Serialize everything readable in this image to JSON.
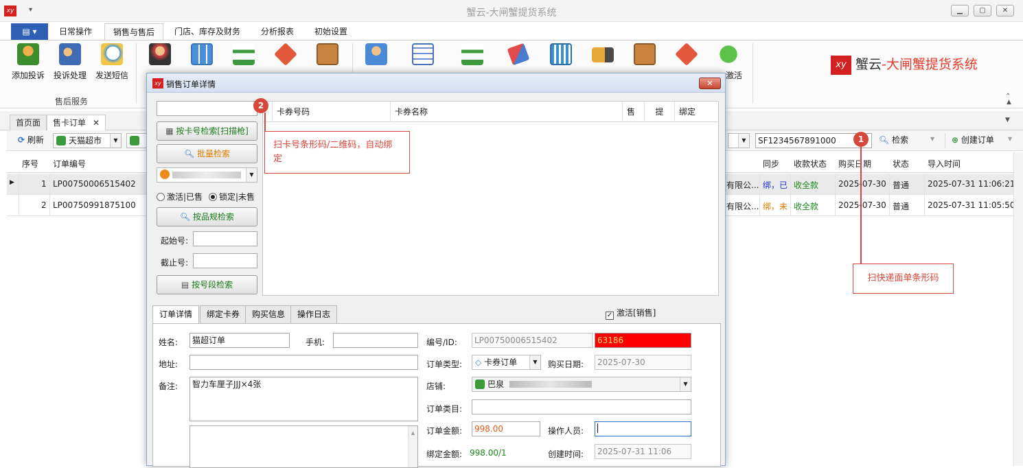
{
  "app": {
    "title": "蟹云-大闸蟹提货系统",
    "logo_text": "xy"
  },
  "ribbon_tabs": [
    {
      "label": "日常操作"
    },
    {
      "label": "销售与售后"
    },
    {
      "label": "门店、库存及财务"
    },
    {
      "label": "分析报表"
    },
    {
      "label": "初始设置"
    }
  ],
  "ribbon": {
    "service_buttons": [
      {
        "label": "添加投诉",
        "icon": "add-complaint-icon"
      },
      {
        "label": "投诉处理",
        "icon": "users-icon"
      },
      {
        "label": "发送短信",
        "icon": "chat-bubble-icon"
      }
    ],
    "group_label": "售后服务",
    "activate_label": "激活",
    "brand_prefix": "蟹云",
    "brand_suffix": "-大闸蟹提货系统"
  },
  "doc_tabs": [
    {
      "label": "首页面"
    },
    {
      "label": "售卡订单"
    }
  ],
  "toolbar": {
    "refresh": "刷新",
    "shop": "天猫超市",
    "tracking_value": "SF1234567891000",
    "search": "检索",
    "create": "创建订单"
  },
  "grid": {
    "headers": {
      "seq": "序号",
      "order_no": "订单编号",
      "sync": "同步",
      "pay_status": "收款状态",
      "date": "购买日期",
      "status": "状态",
      "import_time": "导入时间"
    },
    "rows": [
      {
        "seq": "1",
        "order_no": "LP00750006515402",
        "company": "有限公...",
        "sync": "绑，已",
        "pay_status": "收全款",
        "date": "2025-07-30",
        "status": "普通",
        "import_time": "2025-07-31 11:06:21"
      },
      {
        "seq": "2",
        "order_no": "LP00750991875100",
        "company": "有限公...",
        "sync": "绑，未",
        "pay_status": "收全款",
        "date": "2025-07-30",
        "status": "普通",
        "import_time": "2025-07-31 11:05:50"
      }
    ]
  },
  "dialog": {
    "title": "销售订单详情",
    "search_by_card": "按卡号检索[扫描枪]",
    "batch_search": "批量检索",
    "radio_activate": "激活|已售",
    "radio_lock": "锁定|未售",
    "search_by_spec": "按品规检索",
    "start_no_label": "起始号:",
    "end_no_label": "截止号:",
    "search_by_range": "按号段检索",
    "card_columns": {
      "code": "卡券号码",
      "name": "卡券名称",
      "sold": "售",
      "picked": "提",
      "bound": "绑定"
    },
    "tabs": [
      {
        "label": "订单详情"
      },
      {
        "label": "绑定卡券"
      },
      {
        "label": "购买信息"
      },
      {
        "label": "操作日志"
      }
    ],
    "activate_check": "激活[销售]",
    "form": {
      "name_label": "姓名:",
      "name_value": "猫超订单",
      "phone_label": "手机:",
      "address_label": "地址:",
      "remark_label": "备注:",
      "remark_value": "智力车厘子JJJ×4张",
      "id_label": "编号/ID:",
      "id_value": "LP00750006515402",
      "id_extra": "63186",
      "type_label": "订单类型:",
      "type_value": "卡券订单",
      "date_label": "购买日期:",
      "date_value": "2025-07-30",
      "shop_label": "店铺:",
      "shop_value": "巴泉",
      "category_label": "订单类目:",
      "amount_label": "订单金额:",
      "amount_value": "998.00",
      "operator_label": "操作人员:",
      "bind_amount_label": "绑定金额:",
      "bind_amount_value": "998.00/1",
      "created_label": "创建时间:",
      "created_value": "2025-07-31 11:06"
    }
  },
  "annotations": {
    "callout1": {
      "num": "1",
      "text": "扫快递面单条形码"
    },
    "callout2": {
      "num": "2",
      "text": "扫卡号条形码/二维码，自动绑定"
    }
  },
  "colors": {
    "accent_red": "#d7473b",
    "file_tab": "#2e5fb5",
    "green_text": "#1a8a1a",
    "id_highlight": "#ff0000"
  }
}
